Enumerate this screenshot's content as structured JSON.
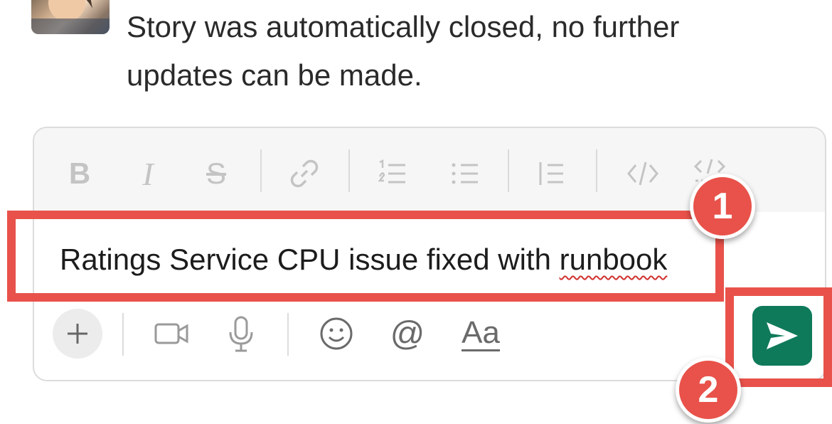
{
  "message": {
    "text": "Story was automatically closed, no further updates can be made."
  },
  "composer": {
    "toolbar": [
      "bold-icon",
      "italic-icon",
      "strikethrough-icon",
      "link-icon",
      "ordered-list-icon",
      "bullet-list-icon",
      "blockquote-icon",
      "code-icon",
      "code-block-icon"
    ],
    "input_text": "Ratings Service CPU issue fixed with ",
    "input_text_misspelled": "runbook",
    "bottom_actions": [
      "plus-icon",
      "video-icon",
      "microphone-icon",
      "emoji-icon",
      "mention-icon",
      "format-icon"
    ],
    "format_label": "Aa",
    "mention_label": "@"
  },
  "annotations": {
    "badge_1": "1",
    "badge_2": "2",
    "color": "#e8524a"
  },
  "colors": {
    "send_button": "#0f7a5a",
    "toolbar_icons": "#c4c4c4",
    "action_icons": "#8a8a8a"
  }
}
